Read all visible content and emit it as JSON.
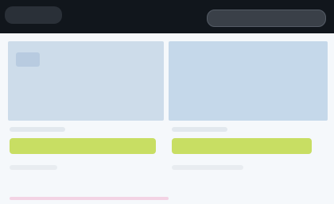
{
  "colors": {
    "topbar": "#11161c",
    "content_bg": "#f5f8fb",
    "panel_left": "#cddcea",
    "panel_right": "#c5d8ea",
    "accent_bar": "#c8de63",
    "pink_strip": "#f3d3e4"
  },
  "topbar": {
    "logo_icon": "logo-icon",
    "search_placeholder": ""
  }
}
